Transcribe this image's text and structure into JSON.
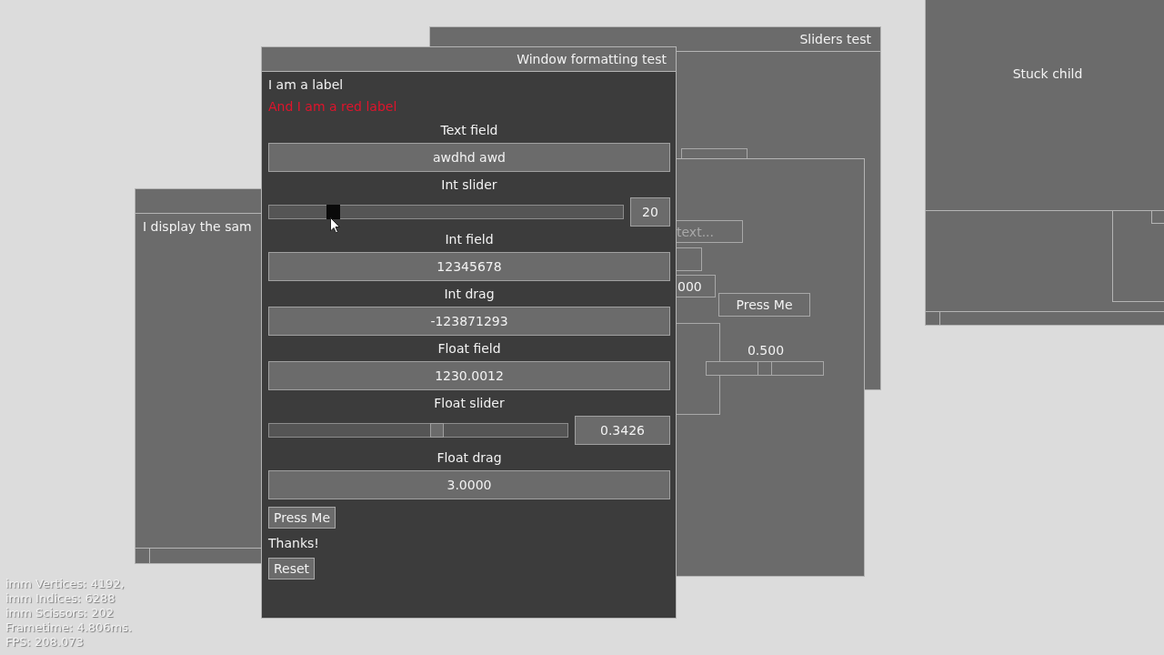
{
  "stuck_window": {
    "label": "Stuck child"
  },
  "sliders_window": {
    "title": "Sliders test"
  },
  "nested_window": {
    "placeholder": "text...",
    "value_field": "000",
    "button": "Press Me",
    "slider_reading": "0.500",
    "slider": {
      "level": 0.5
    }
  },
  "left_window": {
    "text": "I display the sam"
  },
  "main_window": {
    "title": "Window formatting test",
    "labels": [
      {
        "text": "I am a label",
        "color": "#f2f2f2"
      },
      {
        "text": "And I am a red label",
        "color": "#e0142c"
      }
    ],
    "controls": [
      {
        "kind": "text",
        "label": "Text field",
        "value": "awdhd awd"
      },
      {
        "kind": "slider",
        "label": "Int slider",
        "level": 0.18,
        "reading": "20",
        "active": true
      },
      {
        "kind": "text",
        "label": "Int field",
        "value": "12345678"
      },
      {
        "kind": "text",
        "label": "Int drag",
        "value": "-123871293"
      },
      {
        "kind": "text",
        "label": "Float field",
        "value": "1230.0012"
      },
      {
        "kind": "slider",
        "label": "Float slider",
        "level": 0.56,
        "reading": "0.3426",
        "active": false
      },
      {
        "kind": "text",
        "label": "Float drag",
        "value": "3.0000"
      }
    ],
    "button": "Press Me",
    "message": "Thanks!",
    "reset": "Reset"
  },
  "stats": [
    "imm Vertices: 4192,",
    "imm Indices: 6288",
    "imm Scissors: 202",
    "Frametime: 4.806ms.",
    "FPS: 208.073"
  ]
}
